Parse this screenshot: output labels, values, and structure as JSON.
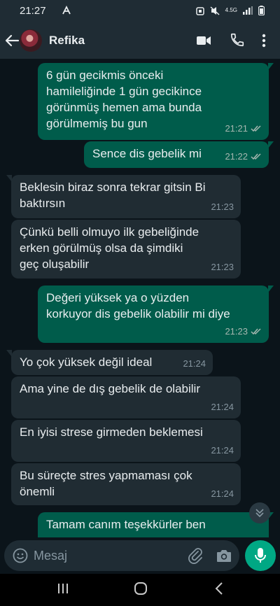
{
  "status_bar": {
    "time": "21:27",
    "network": "4.5G"
  },
  "header": {
    "contact_name": "Refika"
  },
  "messages": [
    {
      "direction": "out",
      "text": "6 gün gecikmis önceki\nhamileliğinde 1 gün gecikince\ngörünmüş hemen ama bunda\ngörülmemiş bu gun",
      "time": "21:21",
      "status": "read"
    },
    {
      "direction": "out",
      "text": "Sence dis gebelik mi",
      "time": "21:22",
      "status": "read"
    },
    {
      "direction": "in",
      "text": "Beklesin biraz sonra tekrar gitsin Bi\nbaktırsın",
      "time": "21:23"
    },
    {
      "direction": "in",
      "text": "Çünkü belli olmuyo ilk gebeliğinde\nerken görülmüş olsa da şimdiki\ngeç oluşabilir",
      "time": "21:23"
    },
    {
      "direction": "out",
      "text": "Değeri yüksek ya o yüzden\nkorkuyor dis gebelik olabilir mi diye",
      "time": "21:23",
      "status": "read"
    },
    {
      "direction": "in",
      "text": "Yo çok yüksek değil ideal",
      "time": "21:24"
    },
    {
      "direction": "in",
      "text": "Ama yine de dış gebelik de olabilir",
      "time": "21:24"
    },
    {
      "direction": "in",
      "text": "En iyisi strese girmeden beklemesi",
      "time": "21:24"
    },
    {
      "direction": "in",
      "text": "Bu süreçte stres yapmaması çok\nönemli",
      "time": "21:24"
    },
    {
      "direction": "out",
      "text": "Tamam canım teşekkürler ben",
      "time": "",
      "status": ""
    }
  ],
  "composer": {
    "placeholder": "Mesaj"
  },
  "colors": {
    "outgoing_bubble": "#005c4b",
    "incoming_bubble": "#202c33",
    "accent": "#00a884",
    "background": "#0b141a"
  }
}
